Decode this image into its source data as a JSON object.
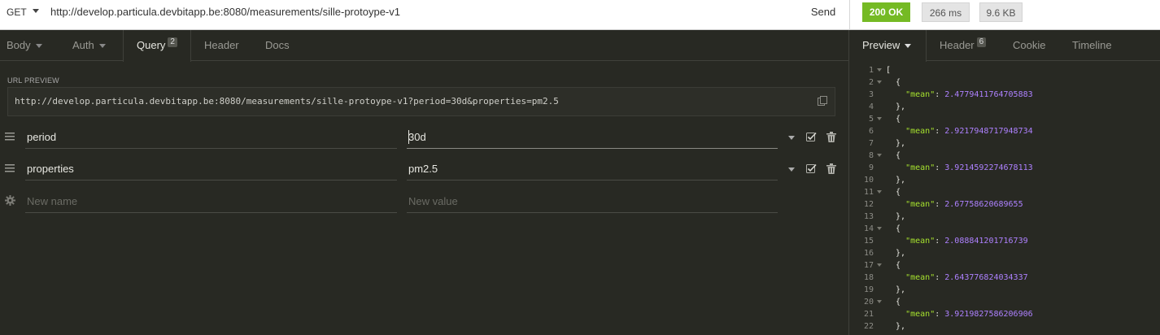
{
  "request": {
    "method": "GET",
    "url": "http://develop.particula.devbitapp.be:8080/measurements/sille-protoype-v1",
    "send_label": "Send"
  },
  "response_meta": {
    "status": "200 OK",
    "time": "266 ms",
    "size": "9.6 KB",
    "status_color": "#75ba24"
  },
  "left_tabs": {
    "body": "Body",
    "auth": "Auth",
    "query": "Query",
    "query_count": "2",
    "header": "Header",
    "docs": "Docs"
  },
  "url_preview": {
    "label": "URL PREVIEW",
    "value": "http://develop.particula.devbitapp.be:8080/measurements/sille-protoype-v1?period=30d&properties=pm2.5"
  },
  "params": [
    {
      "name": "period",
      "value": "30d"
    },
    {
      "name": "properties",
      "value": "pm2.5"
    }
  ],
  "new_param": {
    "name_placeholder": "New name",
    "value_placeholder": "New value"
  },
  "right_tabs": {
    "preview": "Preview",
    "header": "Header",
    "header_count": "6",
    "cookie": "Cookie",
    "timeline": "Timeline"
  },
  "code_lines": [
    {
      "n": "1",
      "text": "[",
      "fold": true
    },
    {
      "n": "2",
      "text": "  {",
      "fold": true
    },
    {
      "n": "3",
      "key": "\"mean\"",
      "value": "2.4779411764705883"
    },
    {
      "n": "4",
      "text": "  },"
    },
    {
      "n": "5",
      "text": "  {",
      "fold": true
    },
    {
      "n": "6",
      "key": "\"mean\"",
      "value": "2.9217948717948734"
    },
    {
      "n": "7",
      "text": "  },"
    },
    {
      "n": "8",
      "text": "  {",
      "fold": true
    },
    {
      "n": "9",
      "key": "\"mean\"",
      "value": "3.9214592274678113"
    },
    {
      "n": "10",
      "text": "  },"
    },
    {
      "n": "11",
      "text": "  {",
      "fold": true
    },
    {
      "n": "12",
      "key": "\"mean\"",
      "value": "2.67758620689655"
    },
    {
      "n": "13",
      "text": "  },"
    },
    {
      "n": "14",
      "text": "  {",
      "fold": true
    },
    {
      "n": "15",
      "key": "\"mean\"",
      "value": "2.088841201716739"
    },
    {
      "n": "16",
      "text": "  },"
    },
    {
      "n": "17",
      "text": "  {",
      "fold": true
    },
    {
      "n": "18",
      "key": "\"mean\"",
      "value": "2.643776824034337"
    },
    {
      "n": "19",
      "text": "  },"
    },
    {
      "n": "20",
      "text": "  {",
      "fold": true
    },
    {
      "n": "21",
      "key": "\"mean\"",
      "value": "3.9219827586206906"
    },
    {
      "n": "22",
      "text": "  },"
    }
  ],
  "icons": {
    "drag": "drag-handle-icon",
    "gear": "gear-icon",
    "copy": "copy-icon",
    "check": "checkbox-icon",
    "trash": "trash-icon"
  }
}
